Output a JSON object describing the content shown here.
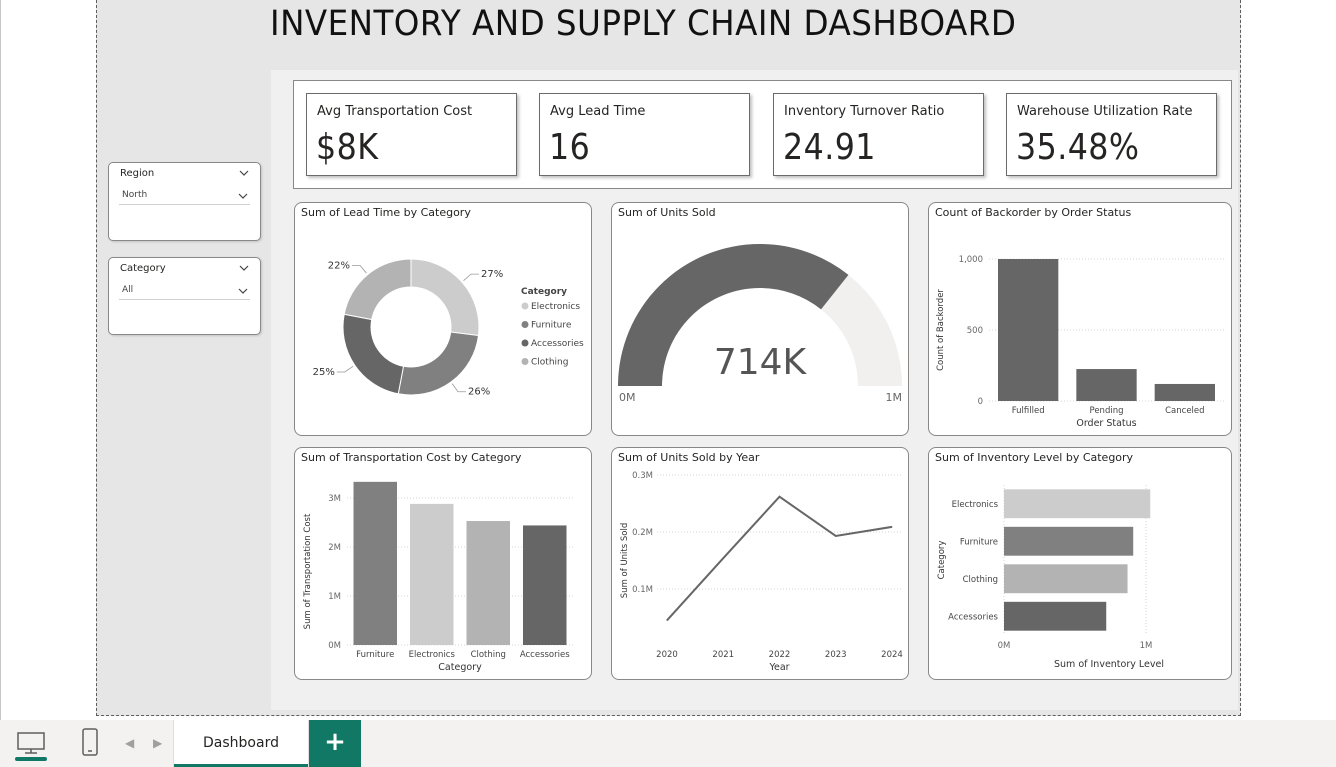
{
  "page_title": "INVENTORY AND SUPPLY CHAIN DASHBOARD",
  "slicers": [
    {
      "title": "Region",
      "value": "North"
    },
    {
      "title": "Category",
      "value": "All"
    }
  ],
  "kpis": [
    {
      "label": "Avg Transportation Cost",
      "value": "$8K"
    },
    {
      "label": "Avg Lead Time",
      "value": "16"
    },
    {
      "label": "Inventory Turnover Ratio",
      "value": "24.91"
    },
    {
      "label": "Warehouse Utilization Rate",
      "value": "35.48%"
    }
  ],
  "colors": {
    "dark": "#666666",
    "mid": "#7f7f7f",
    "light": "#bfbfbf",
    "lighter": "#cccccc",
    "track": "#f1f0ef",
    "accent": "#117865"
  },
  "chart_data": [
    {
      "type": "pie",
      "title": "Sum of Lead Time by Category",
      "legend_title": "Category",
      "legend_position": "right",
      "slices": [
        {
          "label": "Electronics",
          "percent_label": "27%",
          "value": 27,
          "color": "#cccccc"
        },
        {
          "label": "Furniture",
          "percent_label": "26%",
          "value": 26,
          "color": "#808080"
        },
        {
          "label": "Accessories",
          "percent_label": "25%",
          "value": 25,
          "color": "#666666"
        },
        {
          "label": "Clothing",
          "percent_label": "22%",
          "value": 22,
          "color": "#b3b3b3"
        }
      ]
    },
    {
      "type": "gauge",
      "title": "Sum of Units Sold",
      "value": 714000,
      "value_label": "714K",
      "min": 0,
      "max": 1000000,
      "min_label": "0M",
      "max_label": "1M"
    },
    {
      "type": "bar",
      "title": "Count of Backorder by Order Status",
      "xlabel": "Order Status",
      "ylabel": "Count of Backorder",
      "categories": [
        "Fulfilled",
        "Pending",
        "Canceled"
      ],
      "values": [
        1000,
        225,
        120
      ],
      "ylim": [
        0,
        1000
      ],
      "yticks": [
        {
          "value": 0,
          "label": "0"
        },
        {
          "value": 500,
          "label": "500"
        },
        {
          "value": 1000,
          "label": "1,000"
        }
      ],
      "grid": true
    },
    {
      "type": "bar",
      "title": "Sum of Transportation Cost by Category",
      "xlabel": "Category",
      "ylabel": "Sum of Transportation Cost",
      "categories": [
        "Furniture",
        "Electronics",
        "Clothing",
        "Accessories"
      ],
      "values": [
        3330000,
        2880000,
        2530000,
        2440000
      ],
      "colors": [
        "#808080",
        "#cccccc",
        "#b3b3b3",
        "#666666"
      ],
      "ylim": [
        0,
        3000000
      ],
      "yticks": [
        {
          "value": 0,
          "label": "0M"
        },
        {
          "value": 1000000,
          "label": "1M"
        },
        {
          "value": 2000000,
          "label": "2M"
        },
        {
          "value": 3000000,
          "label": "3M"
        }
      ],
      "grid": true
    },
    {
      "type": "line",
      "title": "Sum of Units Sold by Year",
      "xlabel": "Year",
      "ylabel": "Sum of Units Sold",
      "x": [
        "2020",
        "2021",
        "2022",
        "2023",
        "2024"
      ],
      "values": [
        45000,
        154000,
        262000,
        193000,
        209000
      ],
      "ylim": [
        0,
        300000
      ],
      "yticks": [
        {
          "value": 100000,
          "label": "0.1M"
        },
        {
          "value": 200000,
          "label": "0.2M"
        },
        {
          "value": 300000,
          "label": "0.3M"
        }
      ],
      "grid": true
    },
    {
      "type": "bar",
      "orientation": "horizontal",
      "title": "Sum of Inventory Level by Category",
      "xlabel": "Sum of Inventory Level",
      "ylabel": "Category",
      "categories": [
        "Electronics",
        "Furniture",
        "Clothing",
        "Accessories"
      ],
      "values": [
        1030000,
        910000,
        870000,
        720000
      ],
      "colors": [
        "#cccccc",
        "#808080",
        "#b3b3b3",
        "#666666"
      ],
      "xlim": [
        0,
        1000000
      ],
      "xticks": [
        {
          "value": 0,
          "label": "0M"
        },
        {
          "value": 1000000,
          "label": "1M"
        }
      ],
      "grid": true
    }
  ],
  "bottom_bar": {
    "desktop_icon": "desktop-layout-icon",
    "mobile_icon": "mobile-layout-icon",
    "tabs": [
      {
        "label": "Dashboard",
        "active": true
      }
    ],
    "add_page": "+"
  }
}
